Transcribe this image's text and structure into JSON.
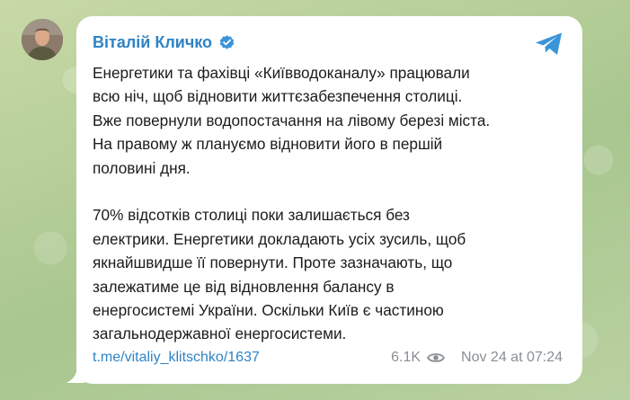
{
  "post": {
    "author": "Віталій Кличко",
    "text": "Енергетики та фахівці «Київводоканалу» працювали\nвсю ніч, щоб відновити життєзабезпечення столиці.\nВже повернули водопостачання на лівому березі міста.\nНа правому ж плануємо відновити його в першій\nполовині дня.\n\n70% відсотків столиці поки залишається без\nелектрики. Енергетики докладають усіх зусиль, щоб\nякнайшвидше її повернути. Проте зазначають, що\nзалежатиме це від відновлення балансу в\nенергосистемі України. Оскільки Київ є частиною\nзагальнодержавної енергосистеми.",
    "link": "t.me/vitaliy_klitschko/1637",
    "views": "6.1K",
    "timestamp": "Nov 24 at 07:24"
  },
  "icons": {
    "avatar": "author-avatar",
    "verified": "verified-badge-icon",
    "telegram": "telegram-icon",
    "views": "eye-icon"
  },
  "colors": {
    "accent": "#2f83c5",
    "meta": "#8a8f94",
    "background": "#b7cf98",
    "card": "#ffffff"
  }
}
